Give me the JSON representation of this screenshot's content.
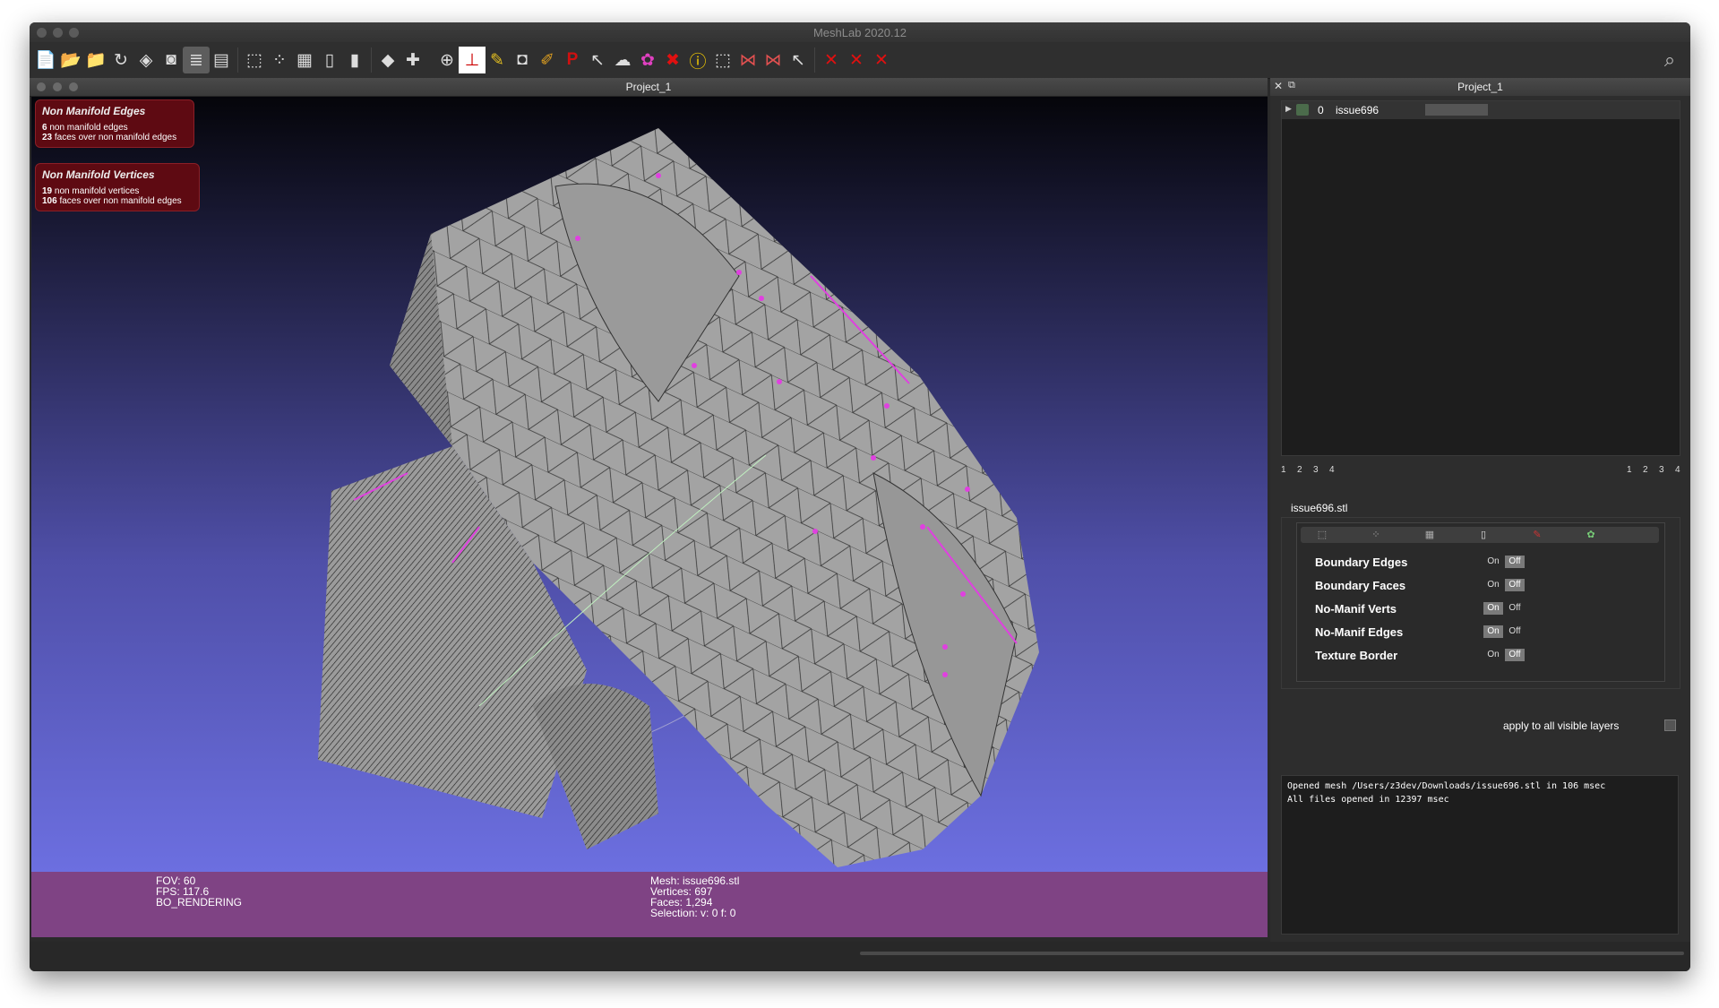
{
  "window": {
    "title": "MeshLab 2020.12"
  },
  "toolbar": {
    "icons": [
      "new-project",
      "open-project",
      "open-mesh",
      "reload",
      "layers",
      "snapshot",
      "layer-dialog",
      "raster",
      "bbox",
      "points",
      "wireframe",
      "flat",
      "smooth",
      "vert-color",
      "axis",
      "trackball",
      "normals",
      "measure",
      "camera",
      "paint",
      "pick-points",
      "select-faces",
      "select-verts",
      "color-tool",
      "delete-faces",
      "info",
      "select-rect",
      "select-conn",
      "select-comp",
      "manip",
      "delete-all",
      "delete-sel",
      "delete-vert"
    ],
    "active": [
      "layer-dialog"
    ]
  },
  "viewer": {
    "title": "Project_1",
    "nm_edges": {
      "title": "Non Manifold Edges",
      "line1_count": "6",
      "line1_text": "non manifold edges",
      "line2_count": "23",
      "line2_text": "faces over non manifold edges"
    },
    "nm_verts": {
      "title": "Non Manifold Vertices",
      "line1_count": "19",
      "line1_text": "non manifold vertices",
      "line2_count": "106",
      "line2_text": "faces over non manifold edges"
    },
    "stats_left": {
      "fov": "FOV: 60",
      "fps": "FPS:   117.6",
      "mode": "BO_RENDERING"
    },
    "stats_right": {
      "mesh": "Mesh: issue696.stl",
      "vertices": "Vertices: 697",
      "faces": "Faces: 1,294",
      "selection": "Selection: v: 0 f: 0"
    }
  },
  "panel": {
    "title": "Project_1",
    "layer": {
      "index": "0",
      "name": "issue696"
    },
    "pages_left": [
      "1",
      "2",
      "3",
      "4"
    ],
    "pages_right": [
      "1",
      "2",
      "3",
      "4"
    ],
    "mesh_name": "issue696.stl",
    "toggles": [
      {
        "label": "Boundary Edges",
        "on": "On",
        "off": "Off",
        "state": "off"
      },
      {
        "label": "Boundary Faces",
        "on": "On",
        "off": "Off",
        "state": "off"
      },
      {
        "label": "No-Manif Verts",
        "on": "On",
        "off": "Off",
        "state": "on"
      },
      {
        "label": "No-Manif Edges",
        "on": "On",
        "off": "Off",
        "state": "on"
      },
      {
        "label": "Texture Border",
        "on": "On",
        "off": "Off",
        "state": "off"
      }
    ],
    "apply_label": "apply to all visible layers",
    "log": [
      "Opened mesh /Users/z3dev/Downloads/issue696.stl in 106 msec",
      "All files opened in 12397 msec"
    ]
  },
  "colors": {
    "viewport_top": "#05050a",
    "viewport_bottom": "#6c6fe0",
    "bottom_bar": "#7f4384",
    "info_bg": "#5e0a12"
  }
}
